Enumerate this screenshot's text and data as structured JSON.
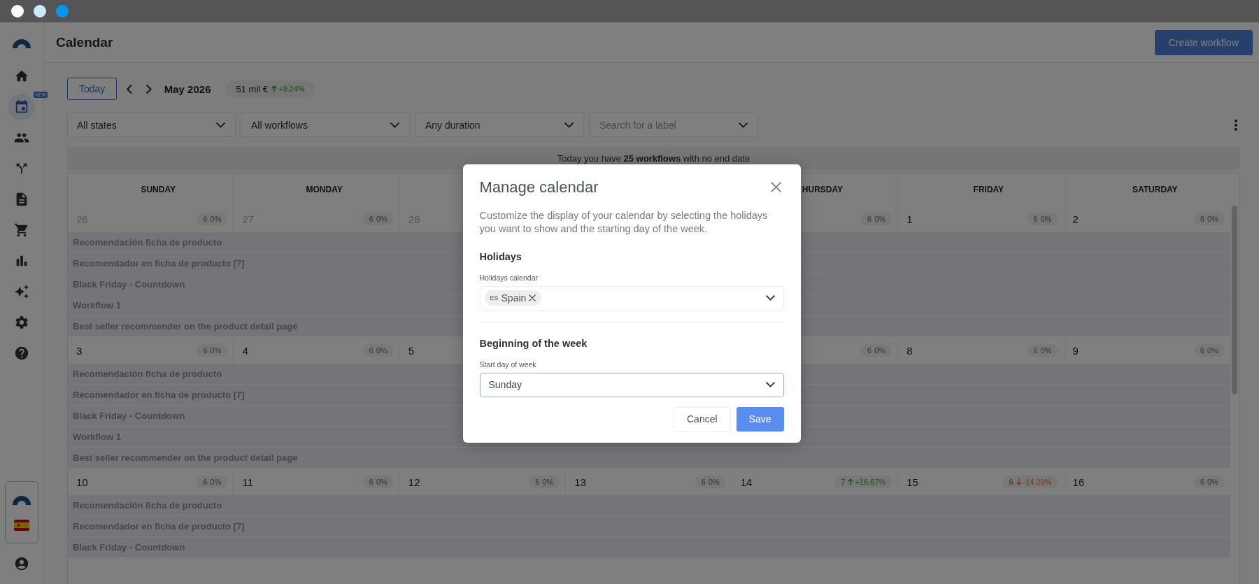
{
  "window": {
    "controls": [
      {
        "color": "#ffffff"
      },
      {
        "color": "#cfe8fb"
      },
      {
        "color": "#0a93f0"
      }
    ]
  },
  "sidebar": {
    "items": [
      {
        "selected": false
      },
      {
        "selected": true,
        "badge": "NEW"
      },
      {
        "selected": false
      },
      {
        "selected": false
      },
      {
        "selected": false
      },
      {
        "selected": false
      },
      {
        "selected": false
      },
      {
        "selected": false
      },
      {
        "selected": false
      },
      {
        "selected": false
      }
    ]
  },
  "header": {
    "title": "Calendar",
    "action": "Create workflow"
  },
  "toolbar": {
    "today": "Today",
    "month": "May 2026",
    "revenue": {
      "value": "51 mil €",
      "kind": "up",
      "change": "+9.24%"
    }
  },
  "filters": [
    {
      "value": "All states"
    },
    {
      "value": "All workflows"
    },
    {
      "value": "Any duration"
    },
    {
      "placeholder": "Search for a label"
    }
  ],
  "banner": "Today you have **25 workflows** with no end date",
  "calendar": {
    "weekdays_left": [
      "SUNDAY",
      "MONDAY"
    ],
    "weekdays_right": [
      "HURSDAY",
      "FRIDAY",
      "SATURDAY"
    ],
    "weeks": [
      {
        "days_left": [
          {
            "number": "26",
            "other_month": true,
            "badge": {
              "count": "6",
              "kind": "flat",
              "change": "0%"
            }
          },
          {
            "number": "27",
            "other_month": true,
            "badge": {
              "count": "6",
              "kind": "flat",
              "change": "0%"
            }
          },
          {
            "number": "28",
            "other_month": true
          }
        ],
        "days_right": [
          {
            "badge": {
              "count": "6",
              "kind": "flat",
              "change": "0%"
            }
          },
          {
            "number": "1",
            "other_month": false,
            "badge": {
              "count": "6",
              "kind": "flat",
              "change": "0%"
            }
          },
          {
            "number": "2",
            "other_month": false,
            "badge": {
              "count": "6",
              "kind": "flat",
              "change": "0%"
            }
          }
        ],
        "workflows": [
          "Recomendación ficha de producto",
          "Recomendador en ficha de producto [7]",
          "Black Friday - Countdown",
          "Workflow 1",
          "Best seller recommender on the product detail page"
        ]
      },
      {
        "days_left": [
          {
            "number": "3",
            "other_month": false,
            "badge": {
              "count": "6",
              "kind": "flat",
              "change": "0%"
            }
          },
          {
            "number": "4",
            "other_month": false,
            "badge": {
              "count": "6",
              "kind": "flat",
              "change": "0%"
            }
          },
          {
            "number": "5",
            "other_month": false
          }
        ],
        "days_right": [
          {
            "badge": {
              "count": "6",
              "kind": "flat",
              "change": "0%"
            }
          },
          {
            "number": "8",
            "other_month": false,
            "badge": {
              "count": "6",
              "kind": "flat",
              "change": "0%"
            }
          },
          {
            "number": "9",
            "other_month": false,
            "badge": {
              "count": "6",
              "kind": "flat",
              "change": "0%"
            }
          }
        ],
        "workflows": [
          "Recomendación ficha de producto",
          "Recomendador en ficha de producto [7]",
          "Black Friday - Countdown",
          "Workflow 1",
          "Best seller recommender on the product detail page"
        ]
      },
      {
        "days_left": [
          {
            "number": "10",
            "other_month": false,
            "badge": {
              "count": "6",
              "kind": "flat",
              "change": "0%"
            }
          },
          {
            "number": "11",
            "other_month": false,
            "badge": {
              "count": "6",
              "kind": "flat",
              "change": "0%"
            }
          },
          {
            "number": "12",
            "other_month": false,
            "badge": {
              "count": "6",
              "kind": "flat",
              "change": "0%"
            }
          },
          {
            "number": "13",
            "other_month": false,
            "badge": {
              "count": "6",
              "kind": "flat",
              "change": "0%"
            }
          },
          {
            "number": "14",
            "other_month": false,
            "badge": {
              "count": "7",
              "kind": "up",
              "change": "+16.67%"
            }
          },
          {
            "number": "15",
            "other_month": false,
            "badge": {
              "count": "6",
              "kind": "down",
              "change": "-14.29%"
            }
          },
          {
            "number": "16",
            "other_month": false,
            "badge": {
              "count": "6",
              "kind": "flat",
              "change": "0%"
            }
          }
        ],
        "workflows": [
          "Recomendación ficha de producto",
          "Recomendador en ficha de producto [7]",
          "Black Friday - Countdown"
        ]
      }
    ]
  },
  "dialog": {
    "title": "Manage calendar",
    "description": "Customize the display of your calendar by selecting the holidays you want to show and the starting day of the week.",
    "sections": [
      {
        "heading": "Holidays",
        "label": "Holidays calendar",
        "kind": "multiselect",
        "chips": [
          {
            "code": "ES",
            "name": "Spain"
          }
        ],
        "focused": false
      },
      {
        "heading": "Beginning of the week",
        "label": "Start day of week",
        "kind": "select",
        "value": "Sunday",
        "focused": true
      }
    ],
    "buttons": [
      {
        "label": "Cancel",
        "primary": false
      },
      {
        "label": "Save",
        "primary": true
      }
    ]
  }
}
